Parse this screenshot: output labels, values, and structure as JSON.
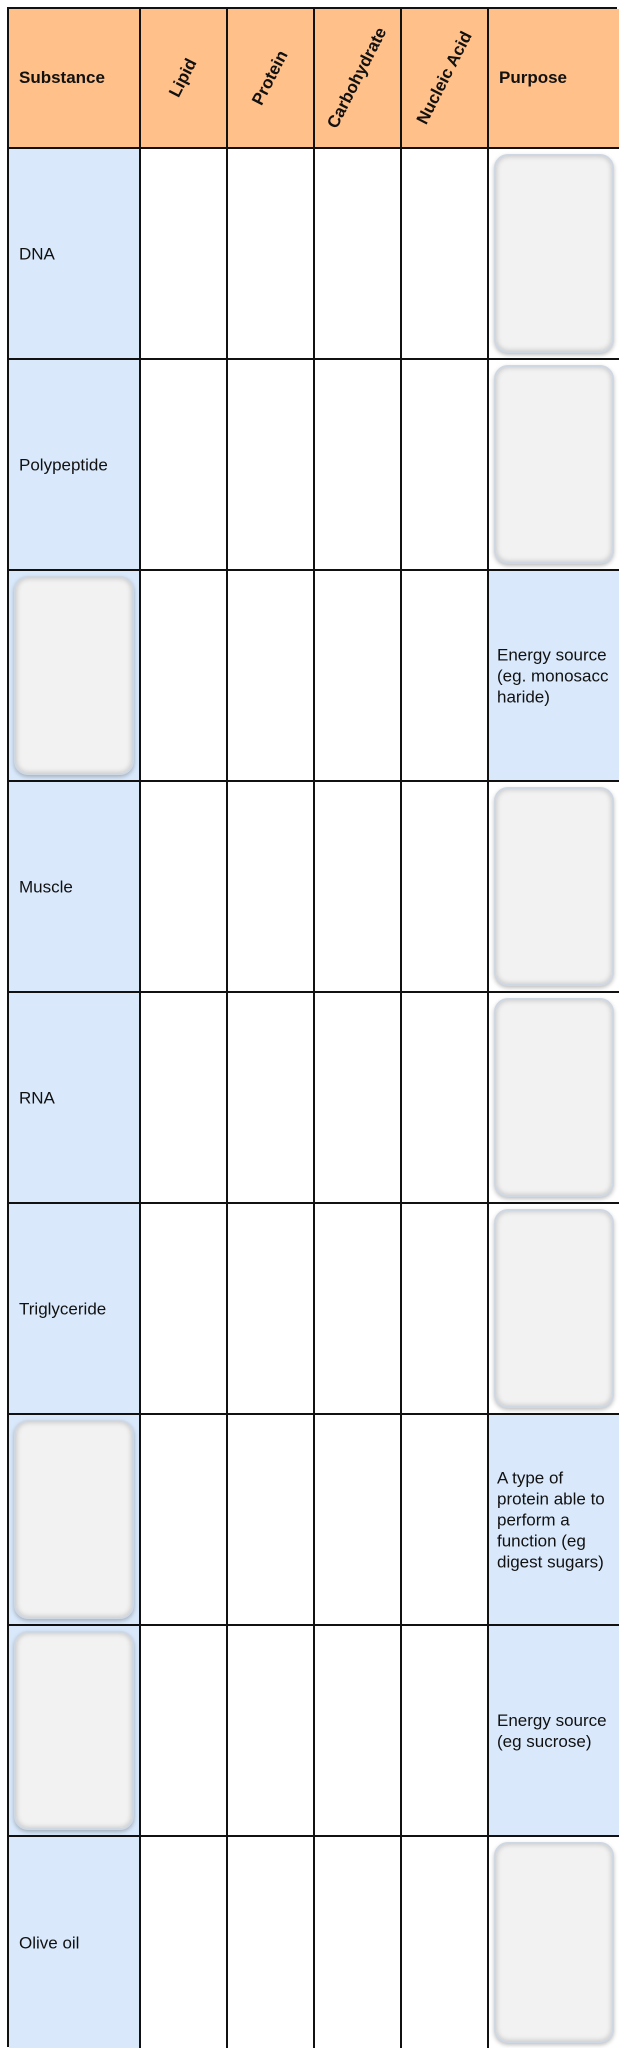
{
  "table": {
    "headers": {
      "substance": "Substance",
      "lipid": "Lipid",
      "protein": "Protein",
      "carbohydrate": "Carbohydrate",
      "nucleic_acid": "Nucleic Acid",
      "purpose": "Purpose"
    },
    "rows": [
      {
        "substance": "DNA",
        "purpose": ""
      },
      {
        "substance": "Polypeptide",
        "purpose": ""
      },
      {
        "substance": "",
        "purpose": "Energy source (eg. monosaccharide)"
      },
      {
        "substance": "Muscle",
        "purpose": ""
      },
      {
        "substance": "RNA",
        "purpose": ""
      },
      {
        "substance": "Triglyceride",
        "purpose": ""
      },
      {
        "substance": "",
        "purpose": "A type of protein able to perform a function (eg digest sugars)"
      },
      {
        "substance": "",
        "purpose": "Energy source (eg sucrose)"
      },
      {
        "substance": "Olive oil",
        "purpose": ""
      }
    ]
  },
  "colors": {
    "header_bg": "#ffc08a",
    "label_bg": "#d9e9fb",
    "drop_box_bg": "#f2f2f2",
    "grid_line": "#111111"
  }
}
